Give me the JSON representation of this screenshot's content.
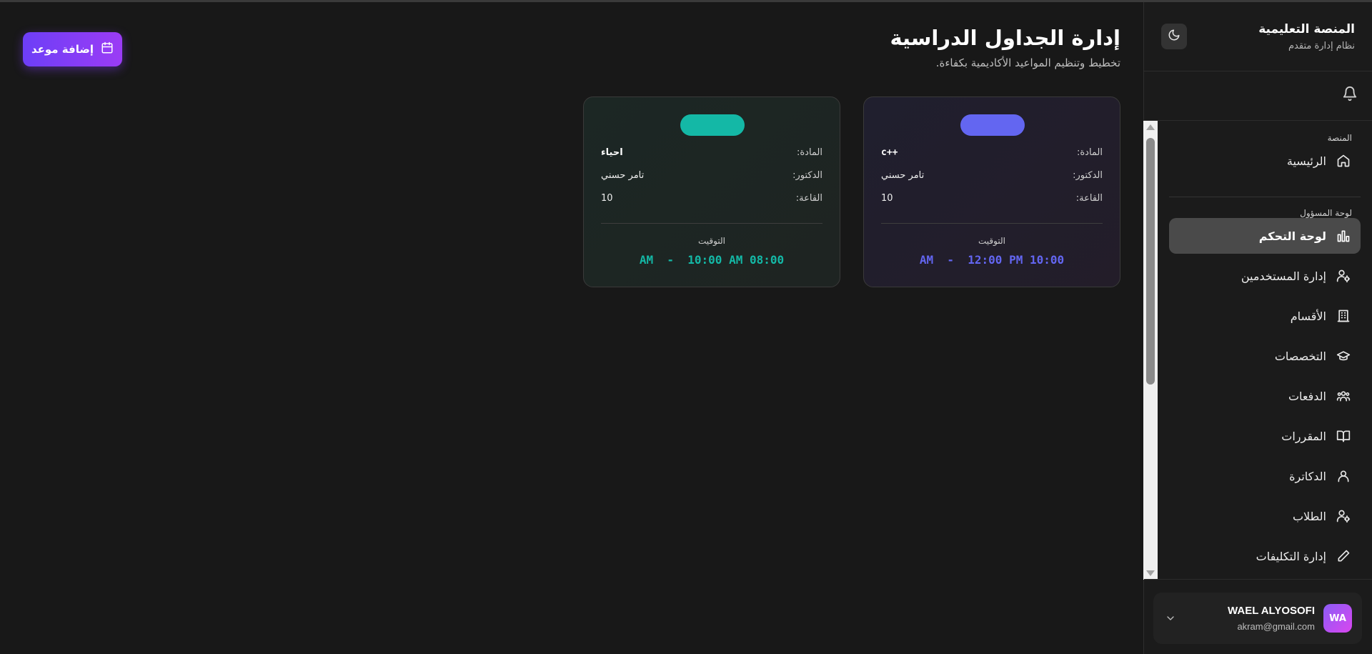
{
  "sidebar": {
    "brand_title": "المنصة التعليمية",
    "brand_subtitle": "نظام إدارة متقدم",
    "section_platform": "المنصة",
    "home": "الرئيسية",
    "section_admin": "لوحة المسؤول",
    "items": [
      {
        "label": "لوحة التحكم",
        "icon": "bar-chart-icon",
        "active": true
      },
      {
        "label": "إدارة المستخدمين",
        "icon": "user-cog-icon",
        "active": false
      },
      {
        "label": "الأقسام",
        "icon": "building-icon",
        "active": false
      },
      {
        "label": "التخصصات",
        "icon": "graduation-cap-icon",
        "active": false
      },
      {
        "label": "الدفعات",
        "icon": "users-group-icon",
        "active": false
      },
      {
        "label": "المقررات",
        "icon": "book-icon",
        "active": false
      },
      {
        "label": "الدكاترة",
        "icon": "user-icon",
        "active": false
      },
      {
        "label": "الطلاب",
        "icon": "user-cog-icon",
        "active": false
      },
      {
        "label": "إدارة التكليفات",
        "icon": "pencil-icon",
        "active": false
      }
    ],
    "user": {
      "initials": "WA",
      "name": "WAEL ALYOSOFI",
      "email": "akram@gmail.com"
    }
  },
  "header": {
    "title": "إدارة الجداول الدراسية",
    "subtitle": "تخطيط وتنظيم المواعيد الأكاديمية بكفاءة.",
    "add_button": "إضافة موعد"
  },
  "cards": [
    {
      "accent": "#6366f1",
      "subject_label": "المادة:",
      "subject": "c++",
      "doctor_label": "الدكتور:",
      "doctor": "تامر حسني",
      "room_label": "القاعة:",
      "room": "10",
      "time_label": "التوقيت",
      "time": "AM  -  12:00 PM 10:00"
    },
    {
      "accent": "#14b8a6",
      "subject_label": "المادة:",
      "subject": "احياء",
      "doctor_label": "الدكتور:",
      "doctor": "تامر حسني",
      "room_label": "القاعة:",
      "room": "10",
      "time_label": "التوقيت",
      "time": "AM  -  10:00 AM 08:00"
    }
  ],
  "colors": {
    "accent_purple": "#7c3aed",
    "teal": "#14b8a6",
    "indigo": "#6366f1"
  }
}
